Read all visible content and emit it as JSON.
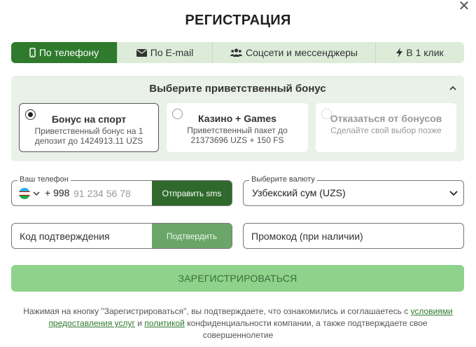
{
  "dialog": {
    "title": "РЕГИСТРАЦИЯ",
    "close_icon": "close-icon"
  },
  "tabs": [
    {
      "label": "По телефону",
      "icon": "phone-icon",
      "active": true
    },
    {
      "label": "По E-mail",
      "icon": "envelope-icon",
      "active": false
    },
    {
      "label": "Соцсети и мессенджеры",
      "icon": "users-icon",
      "active": false
    },
    {
      "label": "В 1 клик",
      "icon": "lightning-icon",
      "active": false
    }
  ],
  "bonus": {
    "title": "Выберите приветственный бонус",
    "options": [
      {
        "title": "Бонус на спорт",
        "desc": "Приветственный бонус на 1 депозит до 1424913.11 UZS",
        "selected": true
      },
      {
        "title": "Казино + Games",
        "desc": "Приветственный пакет до 21373696 UZS + 150 FS",
        "selected": false
      },
      {
        "title": "Отказаться от бонусов",
        "desc": "Сделайте свой выбор позже",
        "selected": false
      }
    ]
  },
  "phone": {
    "label": "Ваш телефон",
    "country_code": "+ 998",
    "placeholder": "91 234 56 78",
    "sms_button": "Отправить sms"
  },
  "currency": {
    "label": "Выберите валюту",
    "value": "Узбекский сум (UZS)"
  },
  "confirmation": {
    "placeholder": "Код подтверждения",
    "button": "Подтвердить"
  },
  "promo": {
    "placeholder": "Промокод (при наличии)"
  },
  "register_button": "ЗАРЕГИСТРИРОВАТЬСЯ",
  "terms": {
    "part1": "Нажимая на кнопку \"Зарегистрироваться\", вы подтверждаете, что ознакомились и соглашаетесь с ",
    "link1": "условиями предоставления услуг",
    "part2": " и ",
    "link2": "политикой",
    "part3": " конфиденциальности компании, а также подтверждаете свое совершеннолетие"
  },
  "colors": {
    "accent": "#2f7a2d",
    "tab_bg": "#dcecd9",
    "panel_bg": "#eaf1e8",
    "register_bg": "#8ed28c"
  }
}
